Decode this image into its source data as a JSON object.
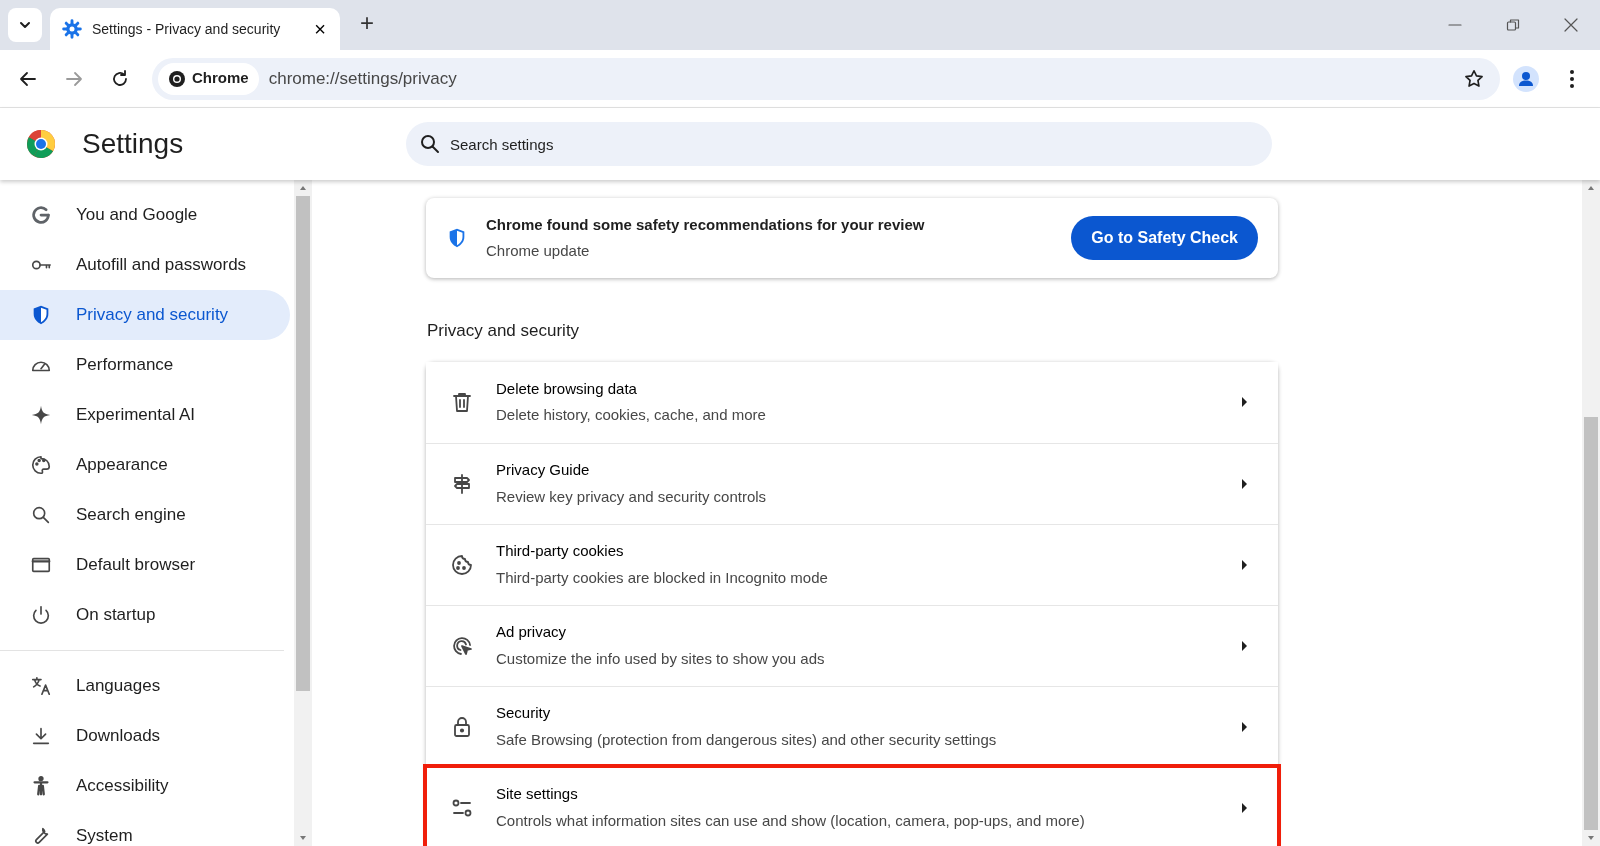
{
  "tabs": [
    {
      "title": "Settings - Privacy and security",
      "selected": true,
      "close": "×"
    }
  ],
  "new_tab": "+",
  "toolbar": {
    "chip": "Chrome",
    "url": "chrome://settings/privacy"
  },
  "header": {
    "title": "Settings",
    "search": {
      "placeholder": "Search settings"
    }
  },
  "sidebar": {
    "sections": [
      {
        "items": [
          {
            "label": "You and Google",
            "selected": false
          },
          {
            "label": "Autofill and passwords",
            "selected": false
          },
          {
            "label": "Privacy and security",
            "selected": true
          },
          {
            "label": "Performance",
            "selected": false
          },
          {
            "label": "Experimental AI",
            "selected": false
          },
          {
            "label": "Appearance",
            "selected": false
          },
          {
            "label": "Search engine",
            "selected": false
          },
          {
            "label": "Default browser",
            "selected": false
          },
          {
            "label": "On startup",
            "selected": false
          }
        ]
      },
      {
        "items": [
          {
            "label": "Languages",
            "selected": false
          },
          {
            "label": "Downloads",
            "selected": false
          },
          {
            "label": "Accessibility",
            "selected": false
          },
          {
            "label": "System",
            "selected": false
          }
        ]
      }
    ]
  },
  "safety_card": {
    "title": "Chrome found some safety recommendations for your review",
    "subtitle": "Chrome update",
    "button": "Go to Safety Check"
  },
  "section_title": "Privacy and security",
  "rows": [
    {
      "title": "Delete browsing data",
      "subtitle": "Delete history, cookies, cache, and more",
      "highlighted": false
    },
    {
      "title": "Privacy Guide",
      "subtitle": "Review key privacy and security controls",
      "highlighted": false
    },
    {
      "title": "Third-party cookies",
      "subtitle": "Third-party cookies are blocked in Incognito mode",
      "highlighted": false
    },
    {
      "title": "Ad privacy",
      "subtitle": "Customize the info used by sites to show you ads",
      "highlighted": false
    },
    {
      "title": "Security",
      "subtitle": "Safe Browsing (protection from dangerous sites) and other security settings",
      "highlighted": false
    },
    {
      "title": "Site settings",
      "subtitle": "Controls what information sites can use and show (location, camera, pop-ups, and more)",
      "highlighted": true
    }
  ]
}
